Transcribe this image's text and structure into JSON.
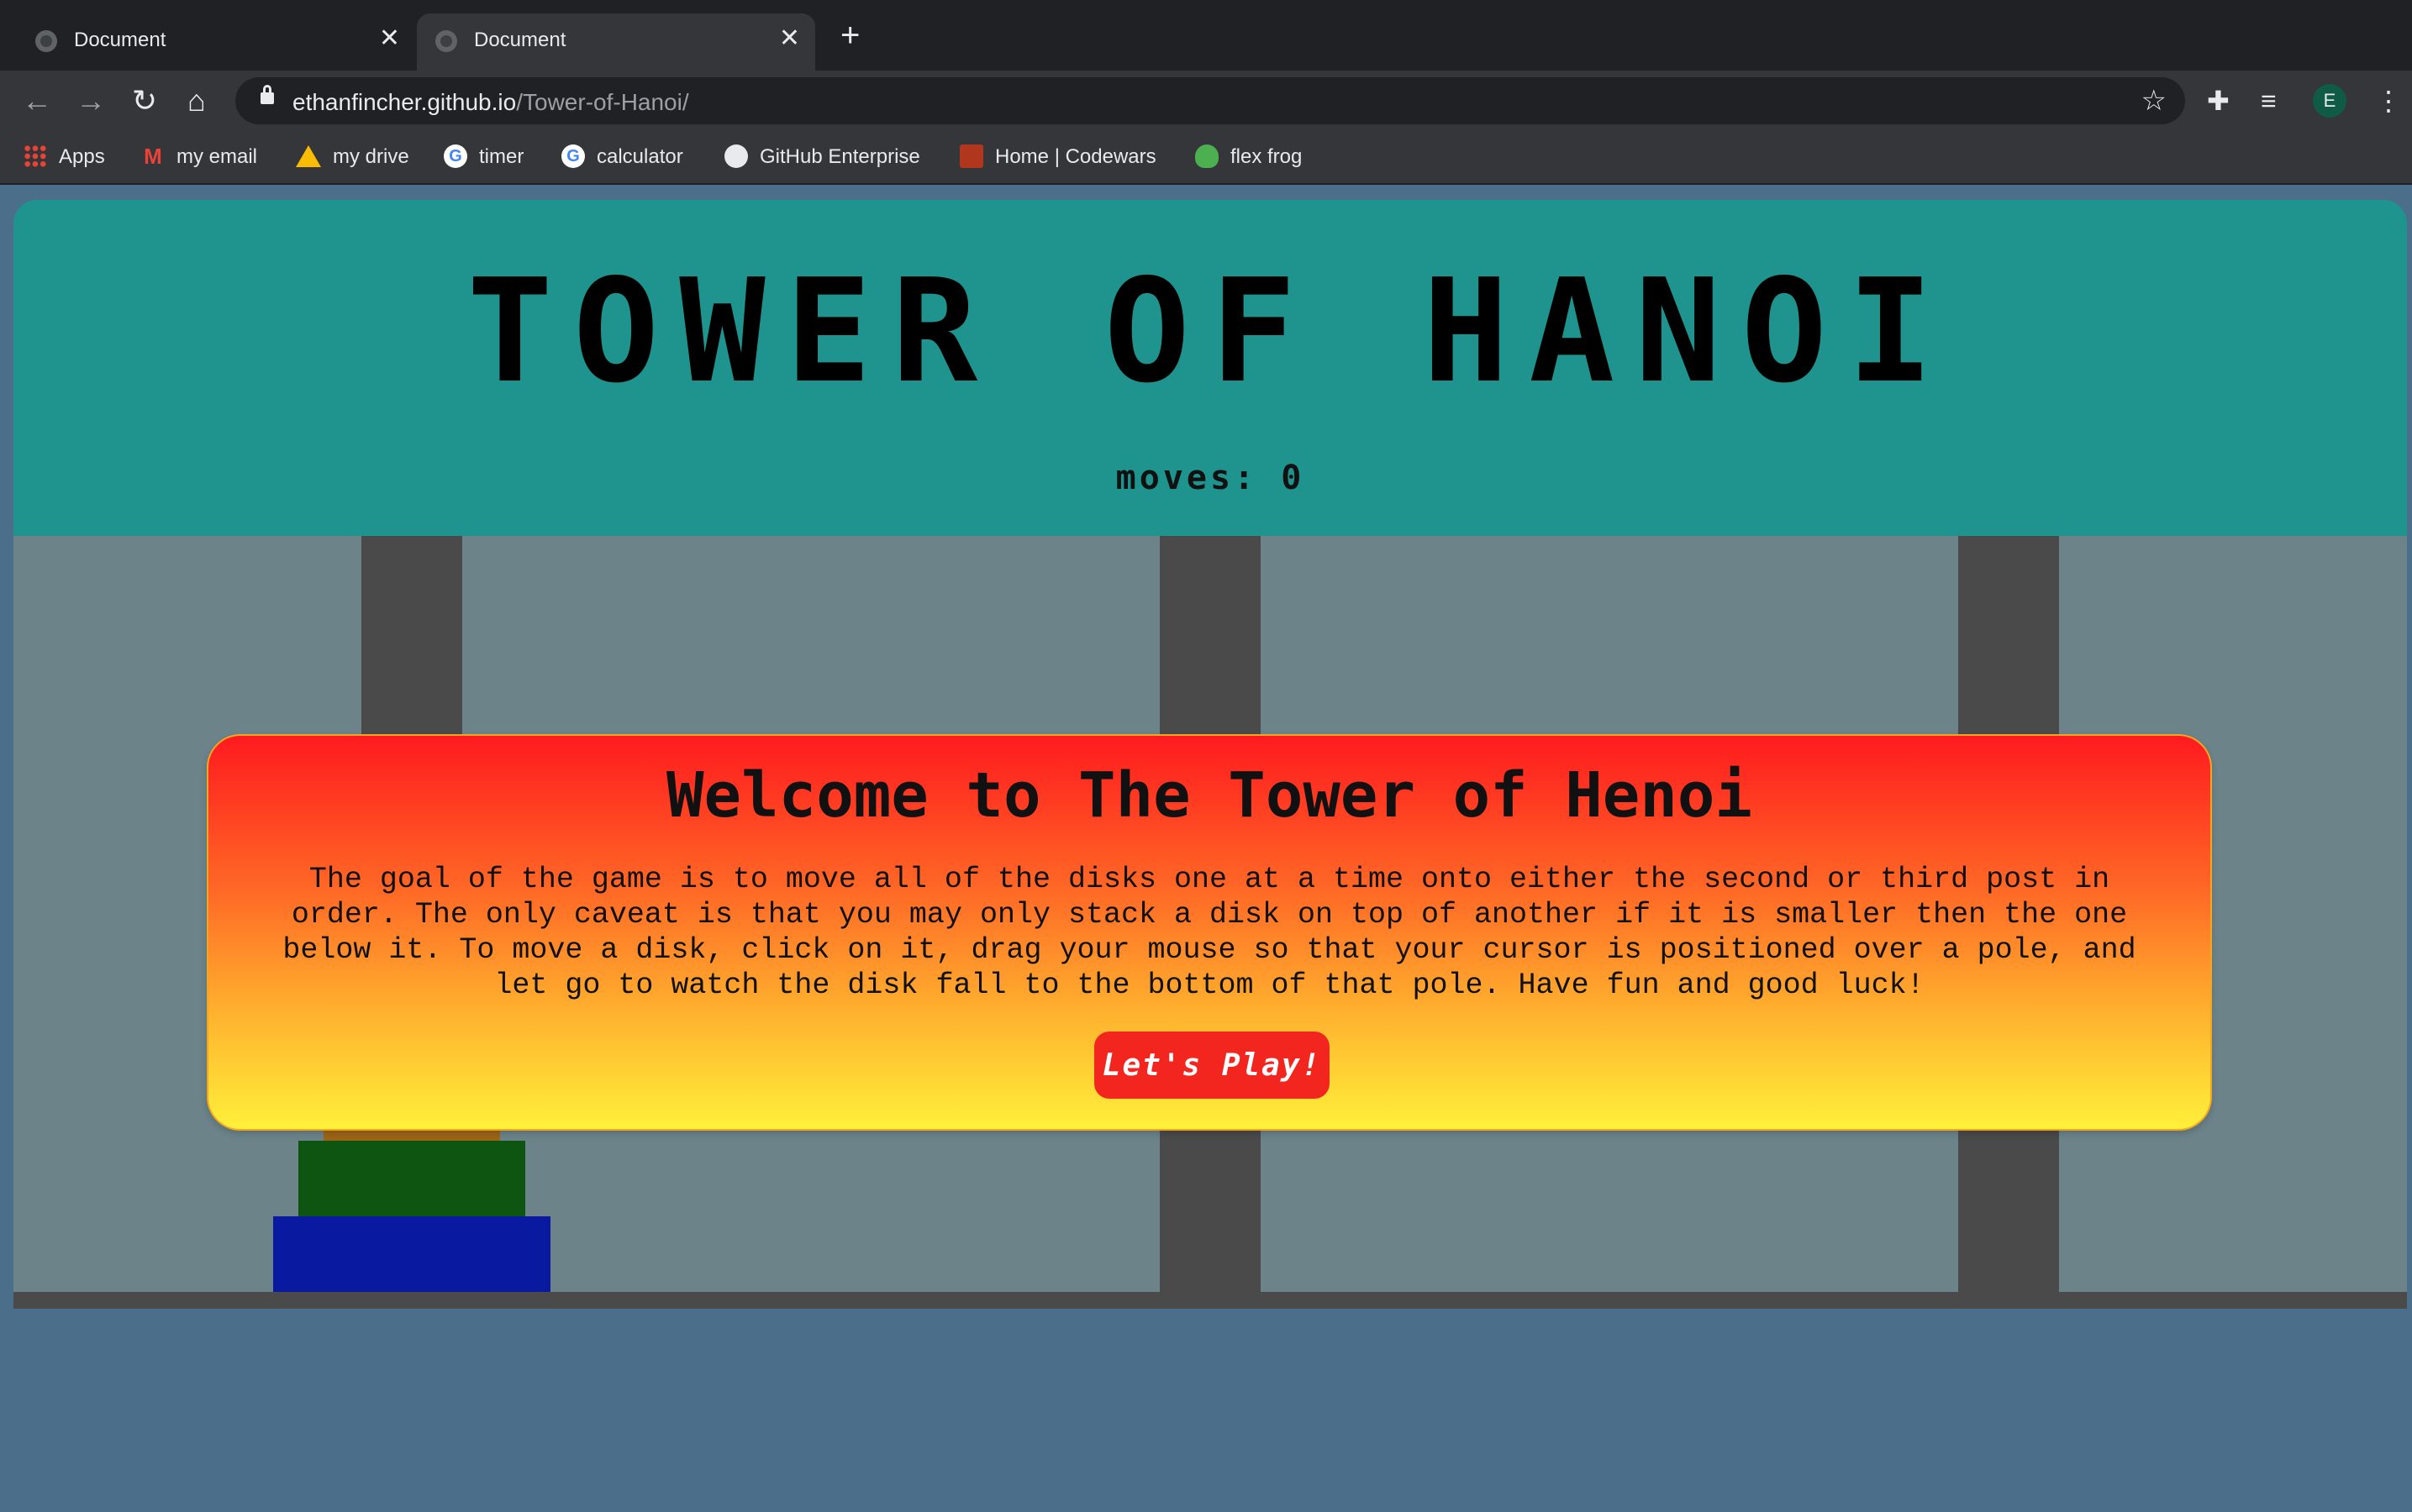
{
  "browser": {
    "tabs": [
      {
        "title": "Document",
        "close": "✕"
      },
      {
        "title": "Document",
        "close": "✕"
      }
    ],
    "new_tab": "+",
    "url_host": "ethanfincher.github.io",
    "url_path": "/Tower-of-Hanoi/",
    "profile_initial": "E",
    "bookmarks": [
      {
        "label": "Apps",
        "icon": "apps-icon"
      },
      {
        "label": "my email",
        "icon": "gmail-icon"
      },
      {
        "label": "my drive",
        "icon": "drive-icon"
      },
      {
        "label": "timer",
        "icon": "google-icon"
      },
      {
        "label": "calculator",
        "icon": "google-icon"
      },
      {
        "label": "GitHub Enterprise",
        "icon": "github-icon"
      },
      {
        "label": "Home | Codewars",
        "icon": "codewars-icon"
      },
      {
        "label": "flex frog",
        "icon": "frog-icon"
      }
    ]
  },
  "game": {
    "title": "TOWER OF HANOI",
    "moves_label": "moves:",
    "moves_value": "0",
    "disks": [
      {
        "color": "#a50d12",
        "size": 1
      },
      {
        "color": "#9c6517",
        "size": 2
      },
      {
        "color": "#0d5511",
        "size": 3
      },
      {
        "color": "#0a1aa0",
        "size": 4
      }
    ],
    "colors": {
      "header": "#1f948e",
      "board": "#6b8389",
      "pole": "#4a4a4a",
      "button": "#f2261f"
    }
  },
  "modal": {
    "title": "Welcome to The Tower of Henoi",
    "text": "The goal of the game is to move all of the disks one at a time onto either the second or third post in order. The only caveat is that you may only stack a disk on top of another if it is smaller then the one below it. To move a disk, click on it, drag your mouse so that your cursor is positioned over a pole, and let go to watch the disk fall to the bottom of that pole. Have fun and good luck!",
    "button_label": "Let's Play!"
  }
}
